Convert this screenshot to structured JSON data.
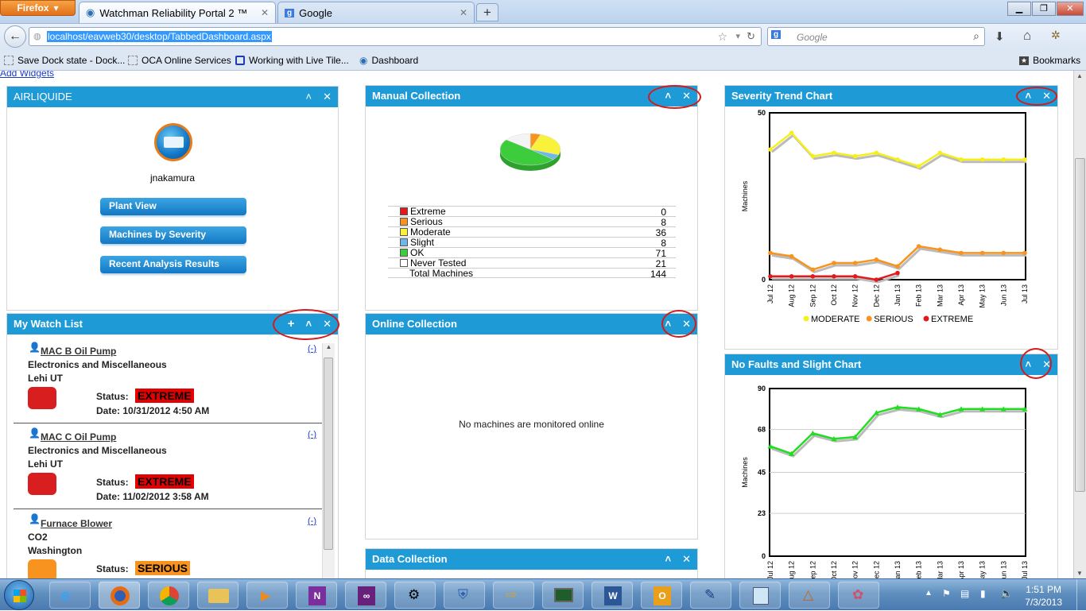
{
  "browser": {
    "menu_button": "Firefox",
    "tabs": [
      {
        "label": "Watchman Reliability Portal 2 ™"
      },
      {
        "label": "Google"
      }
    ],
    "url": "localhost/eavweb30/desktop/TabbedDashboard.aspx",
    "search_placeholder": "Google",
    "bookmarks": [
      {
        "label": "Save Dock state - Dock..."
      },
      {
        "label": "OCA Online Services"
      },
      {
        "label": "Working with Live Tile..."
      },
      {
        "label": "Dashboard"
      }
    ],
    "bookmarks_menu": "Bookmarks"
  },
  "page": {
    "add_widgets": "Add Widgets",
    "airliquide": {
      "title": "AIRLIQUIDE",
      "user": "jnakamura",
      "buttons": [
        "Plant View",
        "Machines by Severity",
        "Recent Analysis Results"
      ]
    },
    "watchlist": {
      "title": "My Watch List",
      "items": [
        {
          "name": "MAC B Oil Pump",
          "category": "Electronics and Miscellaneous",
          "location": "Lehi UT",
          "status_label": "Status:",
          "status": "EXTREME",
          "status_color": "#e40000",
          "date": "Date: 10/31/2012 4:50 AM",
          "remove": "(-)"
        },
        {
          "name": "MAC C Oil Pump",
          "category": "Electronics and Miscellaneous",
          "location": "Lehi UT",
          "status_label": "Status:",
          "status": "EXTREME",
          "status_color": "#e40000",
          "date": "Date: 11/02/2012 3:58 AM",
          "remove": "(-)"
        },
        {
          "name": "Furnace Blower",
          "category": "CO2",
          "location": "Washington",
          "status_label": "Status:",
          "status": "SERIOUS",
          "status_color": "#f7931e",
          "date": "",
          "remove": "(-)"
        }
      ]
    },
    "manual": {
      "title": "Manual Collection",
      "legend": [
        {
          "label": "Extreme",
          "value": "0",
          "color": "#e11b1b"
        },
        {
          "label": "Serious",
          "value": "8",
          "color": "#f7931e"
        },
        {
          "label": "Moderate",
          "value": "36",
          "color": "#f8f23a"
        },
        {
          "label": "Slight",
          "value": "8",
          "color": "#6db7ea"
        },
        {
          "label": "OK",
          "value": "71",
          "color": "#3ccc3c"
        },
        {
          "label": "Never Tested",
          "value": "21",
          "color": "#ffffff"
        }
      ],
      "total_label": "Total Machines",
      "total_value": "144"
    },
    "online": {
      "title": "Online Collection",
      "message": "No machines are monitored online"
    },
    "data_collection": {
      "title": "Data Collection"
    },
    "severity_chart": {
      "title": "Severity Trend Chart"
    },
    "nofaults_chart": {
      "title": "No Faults and Slight Chart"
    }
  },
  "chart_data": [
    {
      "type": "line",
      "title": "Severity Trend Chart",
      "ylabel": "Machines",
      "ylim": [
        0,
        50
      ],
      "yticks": [
        "50",
        "0"
      ],
      "categories": [
        "Jul 12",
        "Aug 12",
        "Sep 12",
        "Oct 12",
        "Nov 12",
        "Dec 12",
        "Jan 13",
        "Feb 13",
        "Mar 13",
        "Apr 13",
        "May 13",
        "Jun 13",
        "Jul 13"
      ],
      "series": [
        {
          "name": "MODERATE",
          "color": "#f5f01c",
          "values": [
            39,
            44,
            37,
            38,
            37,
            38,
            36,
            34,
            38,
            36,
            36,
            36,
            36
          ]
        },
        {
          "name": "SERIOUS",
          "color": "#f7931e",
          "values": [
            8,
            7,
            3,
            5,
            5,
            6,
            4,
            10,
            9,
            8,
            8,
            8,
            8
          ]
        },
        {
          "name": "EXTREME",
          "color": "#e11b1b",
          "values": [
            1,
            1,
            1,
            1,
            1,
            0,
            2,
            null,
            null,
            null,
            null,
            null,
            null
          ]
        }
      ],
      "legend_position": "bottom"
    },
    {
      "type": "line",
      "title": "No Faults and Slight Chart",
      "ylabel": "Machines",
      "ylim": [
        0,
        90
      ],
      "yticks": [
        "90",
        "68",
        "45",
        "23",
        "0"
      ],
      "categories": [
        "Jul 12",
        "Aug 12",
        "Sep 12",
        "Oct 12",
        "Nov 12",
        "Dec 12",
        "Jan 13",
        "Feb 13",
        "Mar 13",
        "Apr 13",
        "May 13",
        "Jun 13",
        "Jul 13"
      ],
      "series": [
        {
          "name": "",
          "color": "#22dd22",
          "values": [
            59,
            55,
            66,
            63,
            64,
            77,
            80,
            79,
            76,
            79,
            79,
            79,
            79
          ]
        }
      ]
    }
  ],
  "taskbar": {
    "time": "1:51 PM",
    "date": "7/3/2013"
  }
}
